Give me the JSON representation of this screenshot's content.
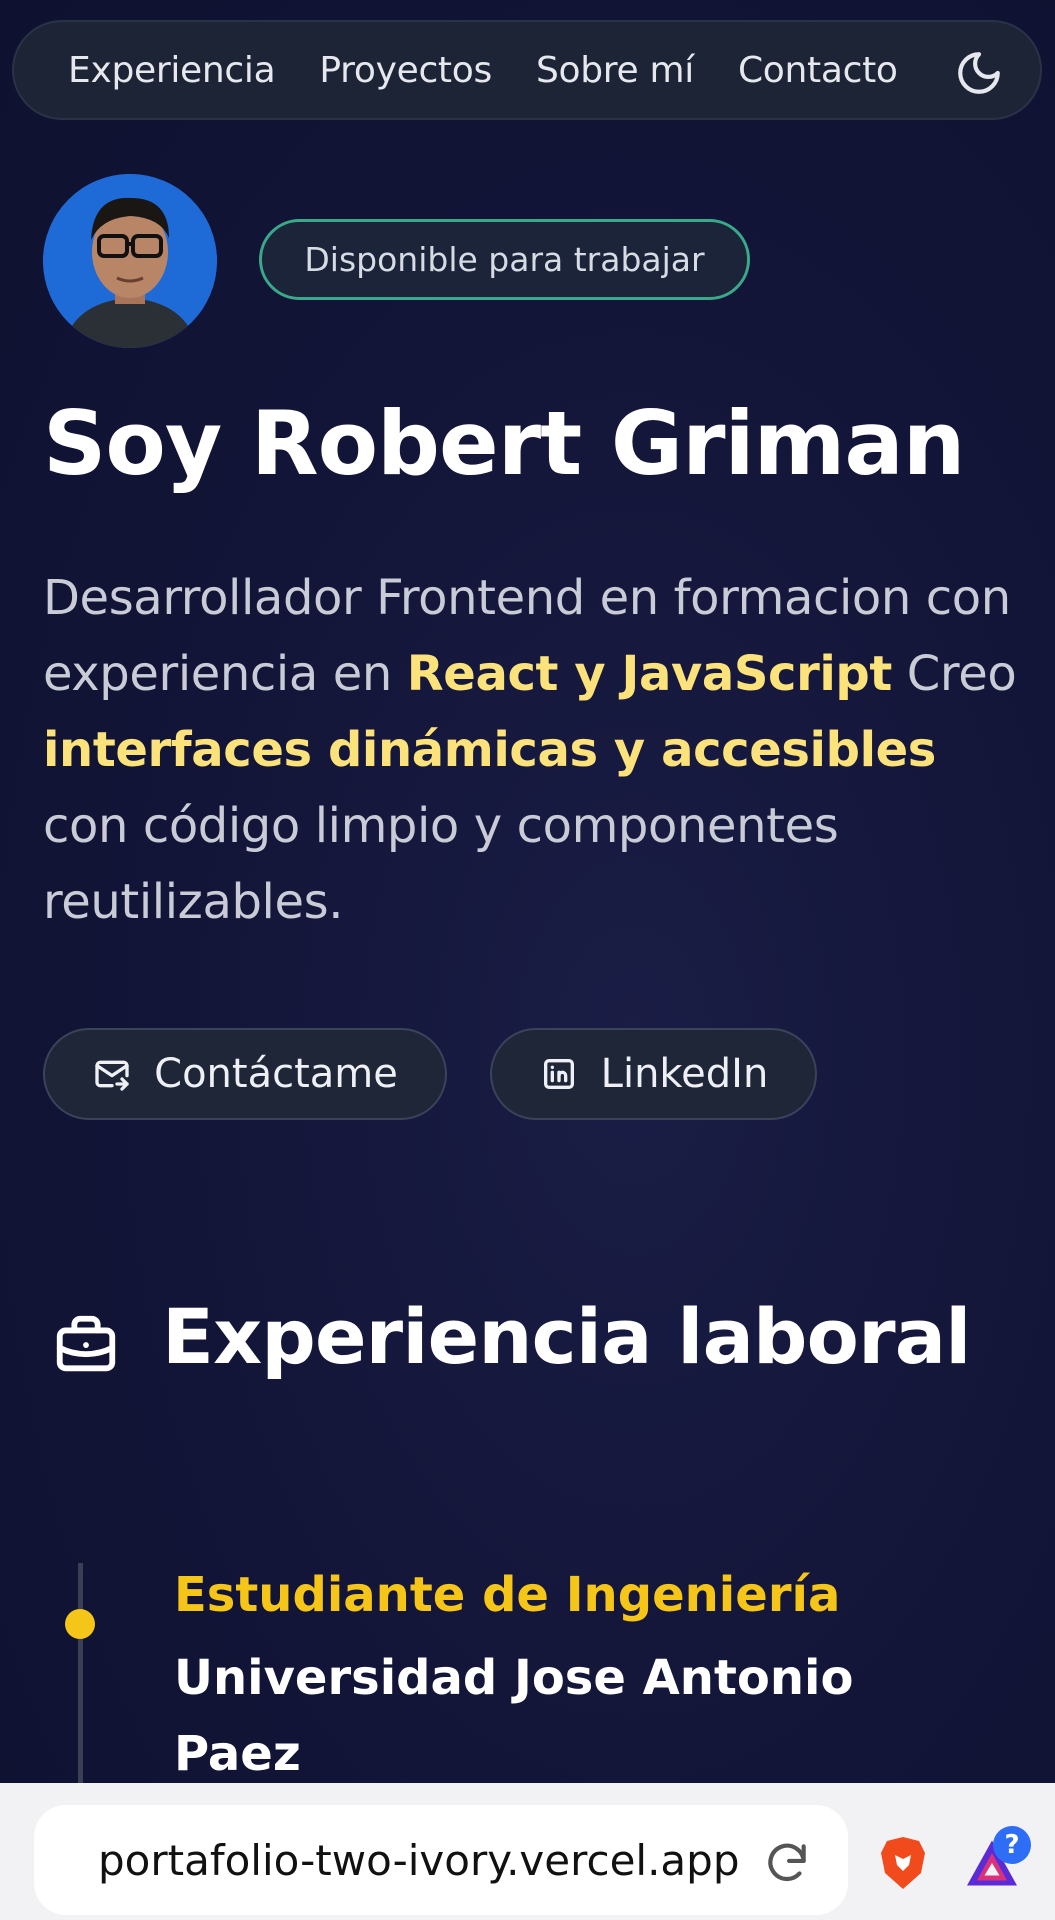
{
  "nav": {
    "items": [
      {
        "label": "Experiencia"
      },
      {
        "label": "Proyectos"
      },
      {
        "label": "Sobre mí"
      },
      {
        "label": "Contacto"
      }
    ],
    "theme_icon": "moon-icon"
  },
  "hero": {
    "avatar_icon": "profile-photo",
    "badge": "Disponible para trabajar",
    "title": "Soy Robert Griman",
    "description": {
      "p1": "Desarrollador Frontend en formacion con experiencia en ",
      "hl1": "React y JavaScript",
      "p2": " Creo ",
      "hl2": "interfaces dinámicas y accesibles",
      "p3": " con código limpio y componentes reutilizables."
    },
    "buttons": {
      "contact": "Contáctame",
      "linkedin": "LinkedIn"
    }
  },
  "experience": {
    "title": "Experiencia laboral",
    "icon": "briefcase-icon",
    "items": [
      {
        "role": "Estudiante de Ingeniería",
        "place": "Universidad Jose Antonio Paez"
      }
    ]
  },
  "browser": {
    "url": "portafolio-two-ivory.vercel.app",
    "help_badge": "?"
  },
  "colors": {
    "accent_yellow": "#f5c518",
    "highlight": "#fbe27a",
    "badge_border": "#3aa88a",
    "background": "#14163a"
  }
}
